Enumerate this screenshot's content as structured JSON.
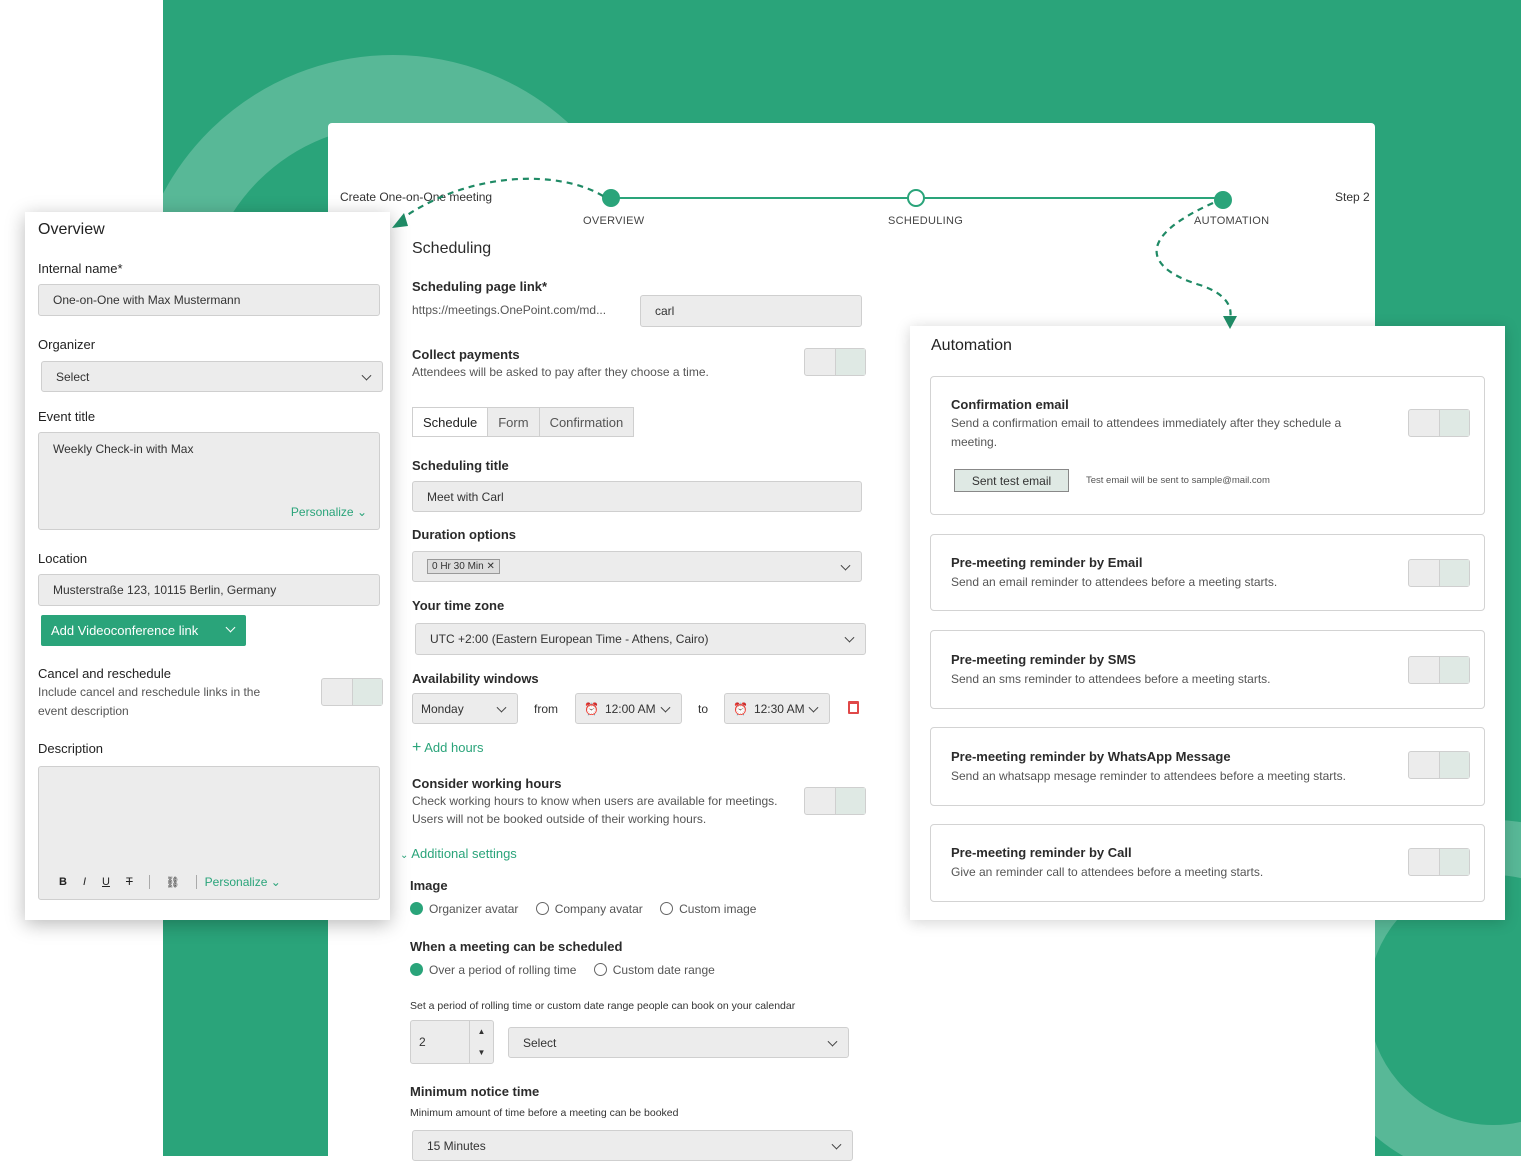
{
  "colors": {
    "brand_green": "#2aa47a",
    "field_bg": "#ececec"
  },
  "header": {
    "breadcrumb": "Create One-on-One meeting",
    "step_counter": "Step 2",
    "steps": [
      {
        "label": "OVERVIEW",
        "state": "completed"
      },
      {
        "label": "SCHEDULING",
        "state": "current"
      },
      {
        "label": "AUTOMATION",
        "state": "completed"
      }
    ]
  },
  "scheduling": {
    "title": "Scheduling",
    "page_link_label": "Scheduling page link*",
    "page_link_prefix": "https://meetings.OnePoint.com/md...",
    "page_link_value": "carl",
    "collect_payments": {
      "title": "Collect payments",
      "desc": "Attendees will be asked to pay after they choose a time."
    },
    "tabs": [
      "Schedule",
      "Form",
      "Confirmation"
    ],
    "scheduling_title_label": "Scheduling title",
    "scheduling_title_value": "Meet with Carl",
    "duration_label": "Duration options",
    "duration_chip": "0 Hr 30 Min",
    "timezone_label": "Your time zone",
    "timezone_value": "UTC +2:00 (Eastern European Time - Athens, Cairo)",
    "availability_label": "Availability windows",
    "availability_day": "Monday",
    "from_label": "from",
    "from_time": "12:00 AM",
    "to_label": "to",
    "to_time": "12:30 AM",
    "add_hours": "Add hours",
    "working_hours": {
      "title": "Consider working hours",
      "desc1": "Check working hours to know when users are available for meetings.",
      "desc2": "Users will not be booked outside of their working hours."
    },
    "additional_settings": "Additional settings",
    "image_label": "Image",
    "image_options": [
      "Organizer avatar",
      "Company avatar",
      "Custom image"
    ],
    "when_label": "When a meeting can be scheduled",
    "when_options": [
      "Over a period of rolling time",
      "Custom date range"
    ],
    "rolling_hint": "Set a period of rolling time or custom date range people can book on your calendar",
    "rolling_number": "2",
    "rolling_unit": "Select",
    "min_notice_label": "Minimum notice time",
    "min_notice_hint": "Minimum amount of time before a meeting can be booked",
    "min_notice_value": "15 Minutes"
  },
  "overview": {
    "title": "Overview",
    "internal_name_label": "Internal name*",
    "internal_name_value": "One-on-One with Max Mustermann",
    "organizer_label": "Organizer",
    "organizer_value": "Select",
    "event_title_label": "Event title",
    "event_title_value": "Weekly Check-in with Max",
    "personalize": "Personalize",
    "location_label": "Location",
    "location_value": "Musterstraße 123, 10115 Berlin, Germany",
    "video_button": "Add Videoconference link",
    "cancel_title": "Cancel and reschedule",
    "cancel_desc1": "Include cancel and reschedule links in the",
    "cancel_desc2": "event description",
    "description_label": "Description",
    "toolbar": {
      "bold": "B",
      "italic": "I",
      "underline": "U",
      "strike": "T",
      "personalize": "Personalize"
    }
  },
  "automation": {
    "title": "Automation",
    "confirmation": {
      "title": "Confirmation email",
      "desc1": "Send a confirmation email to attendees immediately after they schedule a",
      "desc2": "meeting.",
      "test_button": "Sent test email",
      "test_hint": "Test email will be sent to sample@mail.com"
    },
    "reminders": [
      {
        "title": "Pre-meeting reminder by Email",
        "desc": "Send an email reminder to attendees before a meeting starts."
      },
      {
        "title": "Pre-meeting reminder by SMS",
        "desc": "Send an sms reminder to attendees before a meeting starts."
      },
      {
        "title": "Pre-meeting reminder by WhatsApp Message",
        "desc": "Send an whatsapp mesage reminder to attendees before a meeting starts."
      },
      {
        "title": "Pre-meeting reminder by Call",
        "desc": "Give an reminder call to attendees before a meeting starts."
      }
    ]
  }
}
